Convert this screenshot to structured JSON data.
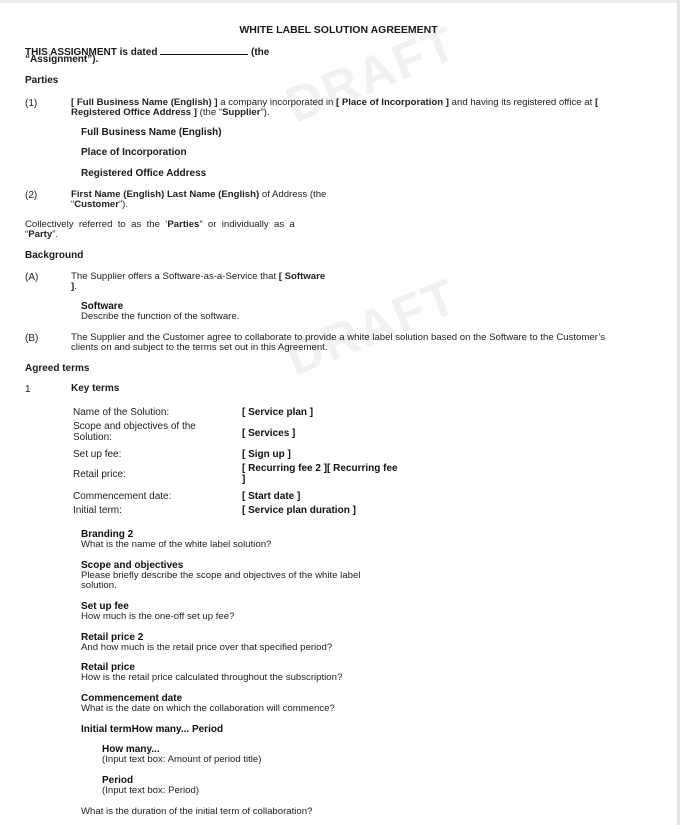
{
  "document": {
    "title": "WHITE LABEL SOLUTION AGREEMENT",
    "watermark": "DRAFT",
    "intro": {
      "prefix": "THIS ASSIGNMENT is dated",
      "suffix": "(the",
      "line2": "“Assignment”)."
    },
    "parties": {
      "heading": "Parties",
      "p1": {
        "num": "(1)",
        "field1": "[ Full Business Name (English) ]",
        "text1": " a company incorporated in ",
        "field2": "[ Place of Incorporation ]",
        "text2": " and having its registered office at ",
        "field3_start": "[",
        "field3_line2": "Registered Office Address ]",
        "text3": " (the “",
        "role": "Supplier",
        "text4": "”)."
      },
      "fields": [
        "Full Business Name (English)",
        "Place of Incorporation",
        "Registered Office Address"
      ],
      "p2": {
        "num": "(2)",
        "name": "First Name (English) Last Name (English)",
        "text1": " of Address (the",
        "text2": "“",
        "role": "Customer",
        "text3": "”)."
      },
      "collective": {
        "line1_a": "Collectively  referred  to  as  the  ‘",
        "parties": "Parties",
        "line1_b": "”  or  individually  as  a",
        "line2_a": "“",
        "party": "Party",
        "line2_b": "”."
      }
    },
    "background": {
      "heading": "Background",
      "a": {
        "num": "(A)",
        "text": "The Supplier offers a Software-as-a-Service that ",
        "field": "[ Software",
        "field_end": "]",
        "end": "."
      },
      "software_note": {
        "heading": "Software",
        "desc": "Describe the function of the software."
      },
      "b": {
        "num": "(B)",
        "line1": "The Supplier and the Customer agree to collaborate to provide a white label solution based on the Software to the Customer’s",
        "line2": "clients on and subject to the terms set out in this Agreement."
      }
    },
    "agreed_terms": {
      "heading": "Agreed terms",
      "section_num": "1",
      "section_title": "Key terms",
      "rows": [
        {
          "label": "Name of the Solution:",
          "value": "[ Service plan ]"
        },
        {
          "label": "Scope and objectives of the",
          "label2": "Solution:",
          "value": "[ Services ]"
        },
        {
          "label": "Set up fee:",
          "value": "[ Sign up ]"
        },
        {
          "label": "Retail price:",
          "value": "[ Recurring fee 2 ][ Recurring fee",
          "value2": "]"
        },
        {
          "label": "Commencement date:",
          "value": "[ Start date ]"
        },
        {
          "label": "Initial term:",
          "value": "[ Service plan duration ]"
        }
      ],
      "questions": [
        {
          "heading": "Branding 2",
          "desc": "What is the name of the white label solution?"
        },
        {
          "heading": "Scope and objectives",
          "desc": "Please briefly describe the scope and objectives of the white label",
          "desc2": "solution."
        },
        {
          "heading": "Set up fee",
          "desc": "How much is the one-off set up fee?"
        },
        {
          "heading": "Retail price 2",
          "desc": "And how much is the retail price over that specified period?"
        },
        {
          "heading": "Retail price",
          "desc": "How is the retail price calculated throughout the subscription?"
        },
        {
          "heading": "Commencement date",
          "desc": "What is the date on which the collaboration will commence?"
        }
      ],
      "initial_term": {
        "heading": "Initial termHow many... Period",
        "subs": [
          {
            "heading": "How many...",
            "desc": "(Input text box: Amount of period title)"
          },
          {
            "heading": "Period",
            "desc": "(Input text box: Period)"
          }
        ],
        "footer": "What is the duration of the initial term of collaboration?"
      }
    }
  }
}
